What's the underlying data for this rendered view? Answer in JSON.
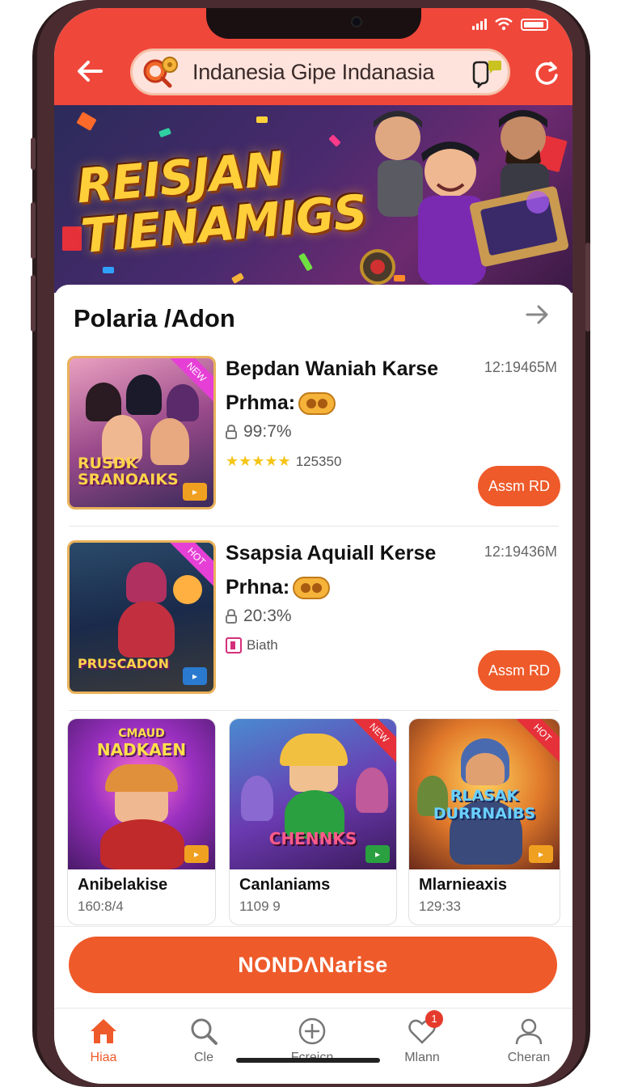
{
  "header": {
    "search_text": "Indanesia Gipe Indanasia"
  },
  "banner": {
    "title_line1": "REISJAN",
    "title_line2": "TIENAMIGS"
  },
  "section": {
    "title": "Polaria /Adon"
  },
  "list": [
    {
      "title": "Bepdan Waniah Karse",
      "time": "12:19465M",
      "subtitle": "Prhma:",
      "percent": "99:7%",
      "rating_text": "125350",
      "stars": 5,
      "thumb_title": "RUSDK SRANOAIKS",
      "action_label": "Assm RD"
    },
    {
      "title": "Ssapsia Aquiall Kerse",
      "time": "12:19436M",
      "subtitle": "Prhna:",
      "percent": "20:3%",
      "extra_text": "Biath",
      "thumb_title": "PRUSCADON",
      "action_label": "Assm RD"
    }
  ],
  "grid": [
    {
      "name": "Anibelakise",
      "count": "160:8/4",
      "img_title": "NADKAEN",
      "img_top": "CMAUD"
    },
    {
      "name": "Canlaniams",
      "count": "1109 9",
      "img_title": "CHENNKS",
      "img_top": ""
    },
    {
      "name": "Mlarnieaxis",
      "count": "129:33",
      "img_title": "RLASAK DURRNAIBS",
      "img_top": ""
    }
  ],
  "cta": {
    "label": "NONDΛNarise"
  },
  "tabs": [
    {
      "label": "Hiaa",
      "icon": "home-icon",
      "active": true
    },
    {
      "label": "Cle",
      "icon": "search-icon",
      "active": false
    },
    {
      "label": "Fcreicn",
      "icon": "add-circle-icon",
      "active": false
    },
    {
      "label": "Mlann",
      "icon": "heart-icon",
      "active": false,
      "badge": "1"
    },
    {
      "label": "Cheran",
      "icon": "profile-icon",
      "active": false
    }
  ],
  "colors": {
    "header": "#f0473b",
    "accent": "#ee5a2a"
  }
}
